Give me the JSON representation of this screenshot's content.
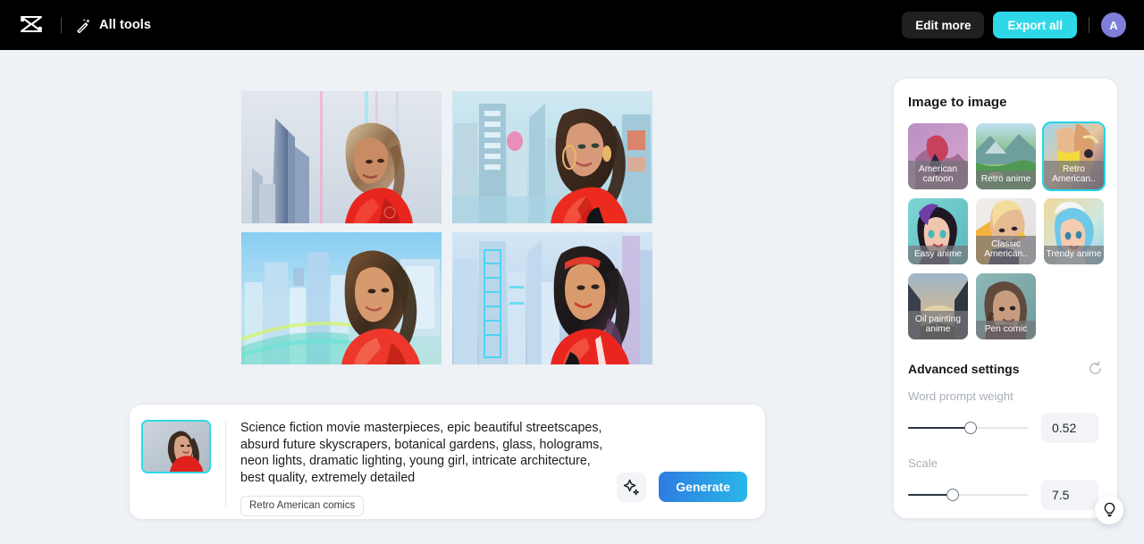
{
  "topbar": {
    "logo_name": "capcut-logo",
    "all_tools_label": "All tools",
    "edit_more_label": "Edit more",
    "export_all_label": "Export all",
    "avatar_initial": "A",
    "colors": {
      "bg": "#000000",
      "export_all": "#2fd8e8",
      "avatar": "#7e7fd9"
    }
  },
  "results": {
    "images": [
      {
        "alt": "Woman in red jacket beside crystalline skyscrapers, pale blue-grey sky"
      },
      {
        "alt": "Woman with dark hair in red top in a teal neon cityscape"
      },
      {
        "alt": "Woman in red jacket over a bright blue city skyline with green rail"
      },
      {
        "alt": "Woman in red jacket before neon-lit blue towers"
      }
    ]
  },
  "prompt": {
    "thumbnail_alt": "Reference photo of woman in red top",
    "text": "Science fiction movie masterpieces, epic beautiful streetscapes, absurd future skyscrapers, botanical gardens, glass, holograms, neon lights, dramatic lighting, young girl, intricate architecture, best quality, extremely detailed",
    "tag": "Retro American comics",
    "sparkle_icon": "sparkle-icon",
    "generate_label": "Generate",
    "generate_gradient": [
      "#2e7ce0",
      "#29b7e8"
    ]
  },
  "right_panel": {
    "title": "Image to image",
    "styles": [
      {
        "label": "American cartoon",
        "selected": false
      },
      {
        "label": "Retro anime",
        "selected": false
      },
      {
        "label": "Retro American..",
        "selected": true
      },
      {
        "label": "Easy anime",
        "selected": false
      },
      {
        "label": "Classic American..",
        "selected": false
      },
      {
        "label": "Trendy anime",
        "selected": false
      },
      {
        "label": "Oil painting anime",
        "selected": false
      },
      {
        "label": "Pen comic",
        "selected": false
      }
    ],
    "selected_color": "#25d4ea",
    "advanced": {
      "title": "Advanced settings",
      "reset_icon": "reset-icon",
      "settings": [
        {
          "label": "Word prompt weight",
          "value": "0.52",
          "percent": 52
        },
        {
          "label": "Scale",
          "value": "7.5",
          "percent": 37
        }
      ]
    }
  },
  "help": {
    "icon": "lightbulb-icon"
  }
}
